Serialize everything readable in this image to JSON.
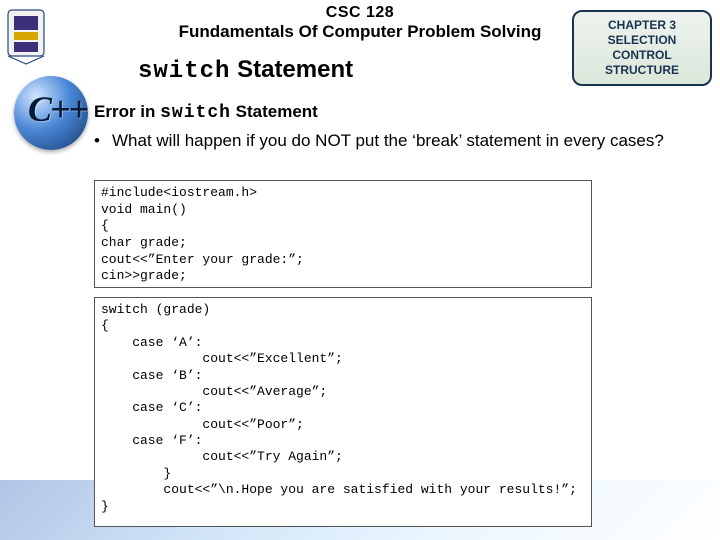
{
  "header": {
    "course_code": "CSC 128",
    "course_title": "Fundamentals Of Computer Problem Solving"
  },
  "chapter_badge": {
    "line1": "CHAPTER 3",
    "line2": "SELECTION CONTROL",
    "line3": "STRUCTURE"
  },
  "cpp_logo_text": "C++",
  "section_title": {
    "mono": "switch",
    "rest": " Statement"
  },
  "sub_title": {
    "prefix": "Error in ",
    "mono": "switch",
    "suffix": " Statement"
  },
  "bullet": {
    "marker": "•",
    "text": "What will happen if you do NOT put the ‘break’ statement in every cases?"
  },
  "code_box1": "#include<iostream.h>\nvoid main()\n{\nchar grade;\ncout<<”Enter your grade:”;\ncin>>grade;",
  "code_box2": "switch (grade)\n{\n    case ‘A’:\n             cout<<”Excellent”;\n    case ‘B’:\n             cout<<”Average”;\n    case ‘C’:\n             cout<<”Poor”;\n    case ‘F’:\n             cout<<”Try Again”;\n        }\n        cout<<”\\n.Hope you are satisfied with your results!”;\n}"
}
